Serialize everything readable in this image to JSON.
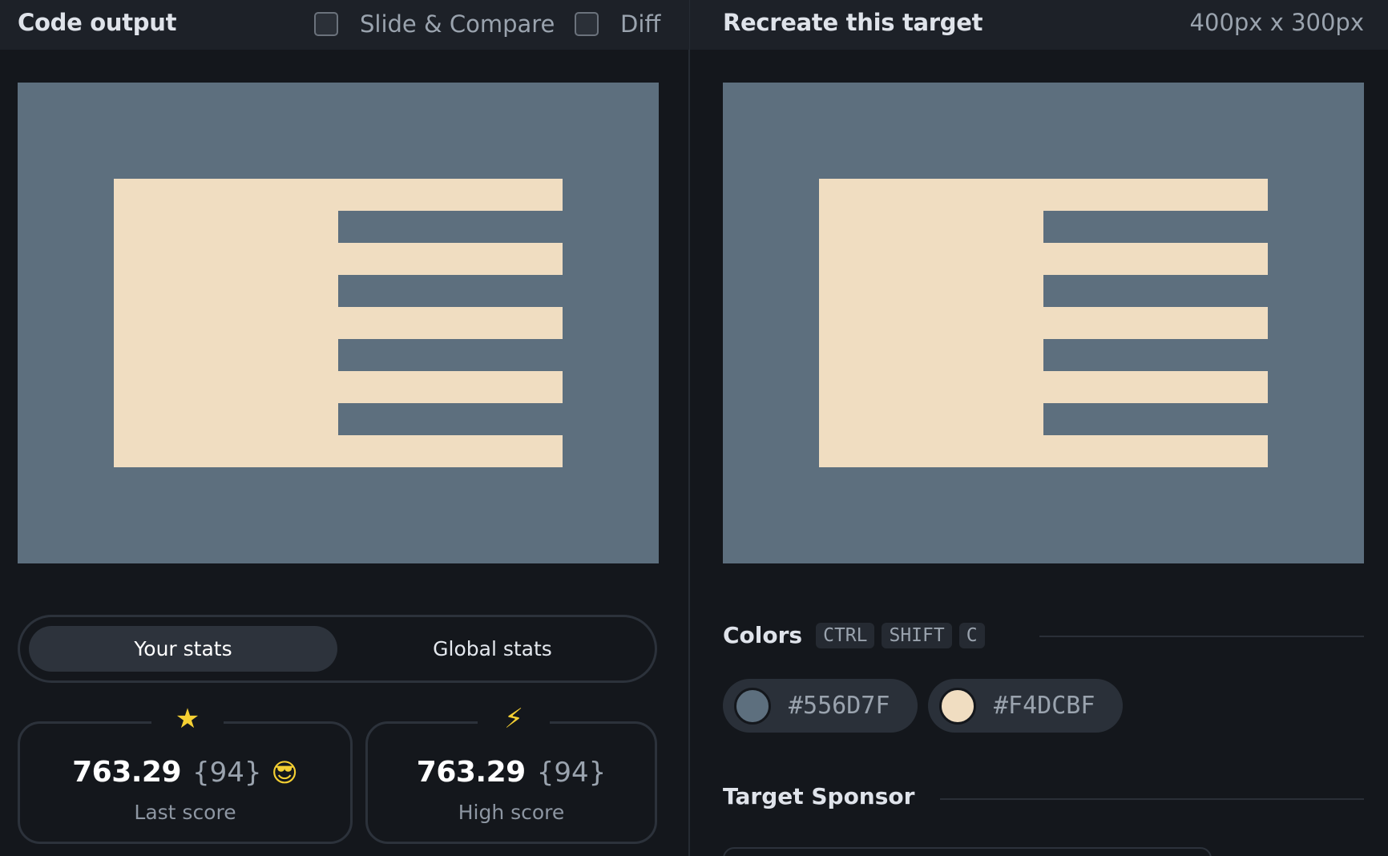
{
  "left_panel": {
    "title": "Code output",
    "toggles": [
      {
        "label": "Slide & Compare",
        "checked": false
      },
      {
        "label": "Diff",
        "checked": false
      }
    ]
  },
  "right_panel": {
    "title": "Recreate this target",
    "dimensions": "400px x 300px"
  },
  "stats": {
    "tabs": [
      "Your stats",
      "Global stats"
    ],
    "active_tab": "Your stats",
    "cards": [
      {
        "icon": "star-icon",
        "value": "763.29",
        "count": "{94}",
        "emoji": "😎",
        "label": "Last score"
      },
      {
        "icon": "lightning-icon",
        "value": "763.29",
        "count": "{94}",
        "label": "High score"
      }
    ]
  },
  "colors": {
    "title": "Colors",
    "shortcut": [
      "CTRL",
      "SHIFT",
      "C"
    ],
    "swatches": [
      {
        "hex": "#556D7F",
        "color": "#5d6f7e"
      },
      {
        "hex": "#F4DCBF",
        "color": "#f0ddc1"
      }
    ]
  },
  "sponsor": {
    "title": "Target Sponsor"
  },
  "theme": {
    "background": "#14171c",
    "topbar": "#1d2128",
    "canvas_bg": "#5d6f7e",
    "canvas_fg": "#f0ddc1",
    "accent": "#f5d033"
  }
}
